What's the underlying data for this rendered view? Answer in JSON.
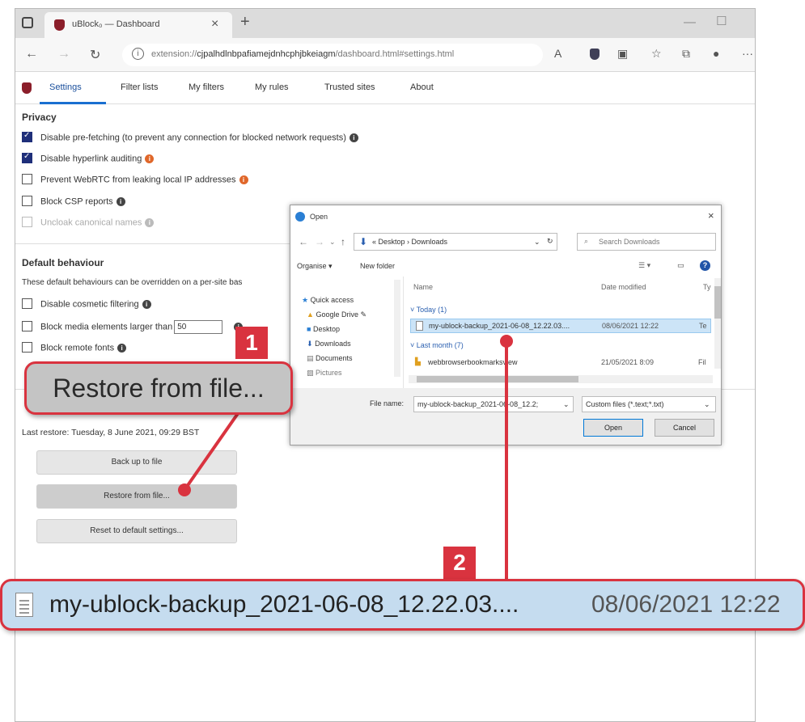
{
  "browser": {
    "tab_title": "uBlock₀ — Dashboard",
    "url_prefix": "extension://",
    "url_id": "cjpalhdlnbpafiamejdnhcphjbkeiagm",
    "url_path": "/dashboard.html#settings.html"
  },
  "nav_tabs": [
    "Settings",
    "Filter lists",
    "My filters",
    "My rules",
    "Trusted sites",
    "About"
  ],
  "privacy": {
    "heading": "Privacy",
    "items": [
      {
        "label": "Disable pre-fetching (to prevent any connection for blocked network requests)",
        "checked": true
      },
      {
        "label": "Disable hyperlink auditing",
        "checked": true
      },
      {
        "label": "Prevent WebRTC from leaking local IP addresses",
        "checked": false
      },
      {
        "label": "Block CSP reports",
        "checked": false
      },
      {
        "label": "Uncloak canonical names",
        "checked": false
      }
    ]
  },
  "default_behaviour": {
    "heading": "Default behaviour",
    "note": "These default behaviours can be overridden on a per-site bas",
    "items": [
      {
        "label": "Disable cosmetic filtering",
        "checked": false
      },
      {
        "label": "Block media elements larger than",
        "checked": false,
        "value": "50"
      },
      {
        "label": "Block remote fonts",
        "checked": false
      }
    ]
  },
  "backup": {
    "last_restore": "Last restore: Tuesday, 8 June 2021, 09:29 BST",
    "buttons": [
      "Back up to file",
      "Restore from file...",
      "Reset to default settings..."
    ]
  },
  "dialog": {
    "title": "Open",
    "breadcrumb": "« Desktop › Downloads",
    "search_placeholder": "Search Downloads",
    "organise": "Organise ▾",
    "new_folder": "New folder",
    "sidebar": [
      "Quick access",
      "Google Drive",
      "Desktop",
      "Downloads",
      "Documents",
      "Pictures"
    ],
    "columns": [
      "Name",
      "Date modified",
      "Ty"
    ],
    "group_today": "˅ Today (1)",
    "group_last_month": "˅ Last month (7)",
    "files": [
      {
        "name": "my-ublock-backup_2021-06-08_12.22.03....",
        "date": "08/06/2021 12:22",
        "type": "Te",
        "selected": true
      },
      {
        "name": "webbrowserbookmarksview",
        "date": "21/05/2021 8:09",
        "type": "Fil",
        "selected": false
      }
    ],
    "file_name_label": "File name:",
    "file_name_value": "my-ublock-backup_2021-06-08_12.2;",
    "file_type": "Custom files (*.text;*.txt)",
    "open_btn": "Open",
    "cancel_btn": "Cancel"
  },
  "callouts": {
    "one": {
      "badge": "1",
      "text": "Restore from file..."
    },
    "two": {
      "badge": "2",
      "file_name": "my-ublock-backup_2021-06-08_12.22.03....",
      "date": "08/06/2021 12:22"
    }
  },
  "colors": {
    "accent_red": "#d9333f",
    "selection_blue": "#c5dcef",
    "tab_blue": "#1a6fd0"
  }
}
